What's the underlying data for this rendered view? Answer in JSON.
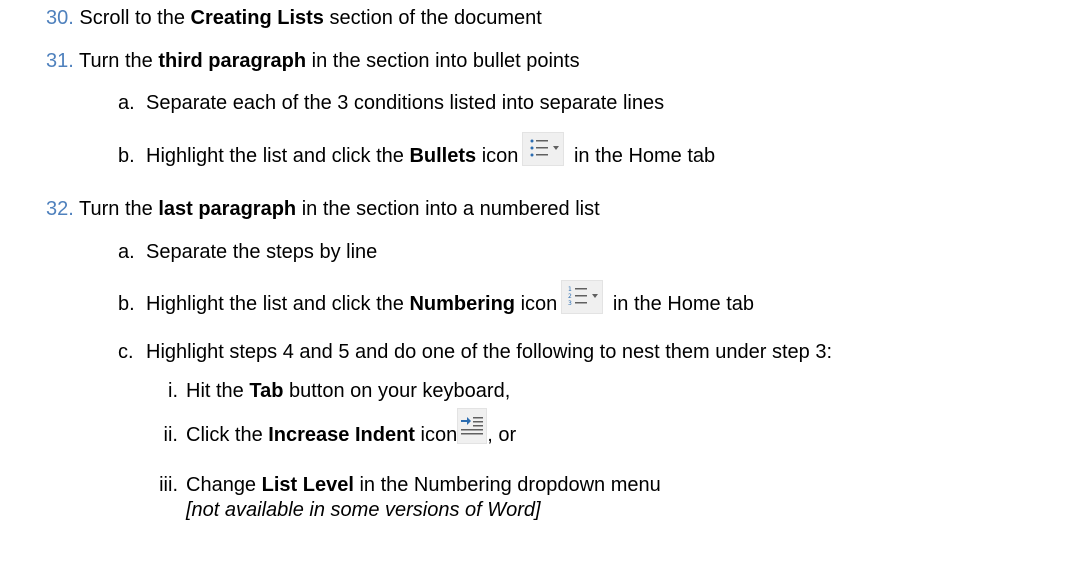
{
  "steps": [
    {
      "num": "30.",
      "pre": "Scroll to the ",
      "bold": "Creating Lists",
      "post": " section of the document"
    },
    {
      "num": "31.",
      "pre": "Turn the ",
      "bold": "third paragraph",
      "post": " in the section into bullet points",
      "subs": [
        {
          "marker": "a.",
          "text": "Separate each of the 3 conditions listed into separate lines"
        },
        {
          "marker": "b.",
          "pre": "Highlight the list and click the ",
          "bold": "Bullets",
          "mid": " icon",
          "icon": "bullets-icon",
          "post": " in the Home tab"
        }
      ]
    },
    {
      "num": "32.",
      "pre": "Turn the ",
      "bold": "last paragraph",
      "post": " in the section into a numbered list",
      "subs": [
        {
          "marker": "a.",
          "text": "Separate the steps by line"
        },
        {
          "marker": "b.",
          "pre": "Highlight the list and click the ",
          "bold": "Numbering",
          "mid": " icon",
          "icon": "numbering-icon",
          "post": " in the Home tab"
        },
        {
          "marker": "c.",
          "text": "Highlight steps 4 and 5 and do one of the following to nest them under step 3:",
          "subs": [
            {
              "marker": "i.",
              "pre": "Hit the ",
              "bold": "Tab",
              "post": " button on your keyboard,"
            },
            {
              "marker": "ii.",
              "pre": "Click the ",
              "bold": "Increase Indent",
              "mid": " icon",
              "icon": "increase-indent-icon",
              "post": ", or"
            },
            {
              "marker": "iii.",
              "pre": "Change ",
              "bold": "List Level",
              "post": " in the Numbering dropdown menu",
              "note": "[not available in some versions of Word]"
            }
          ]
        }
      ]
    }
  ],
  "colors": {
    "step_number": "#4f81bd",
    "icon_blue": "#2b6cb0",
    "icon_background": "#f0f0f0"
  }
}
